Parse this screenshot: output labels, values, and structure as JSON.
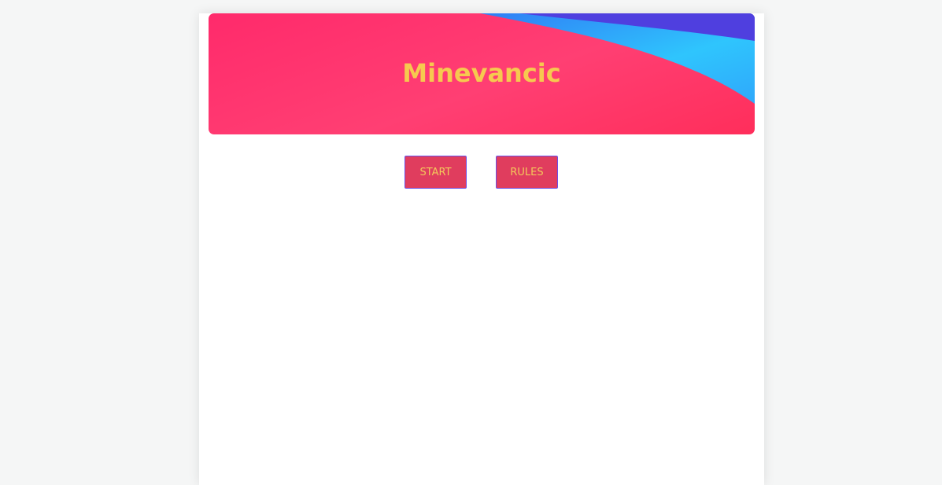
{
  "header": {
    "title": "Minevancic",
    "colors": {
      "banner_pink": "#ff2a6b",
      "swoosh_blue": "#2fbdfd",
      "swoosh_purple": "#4f3fdf",
      "title_color": "#f6c94f"
    }
  },
  "menu": {
    "start_label": "START",
    "rules_label": "RULES",
    "button_color": "#e03d5e",
    "button_border": "#6b4fe6"
  }
}
